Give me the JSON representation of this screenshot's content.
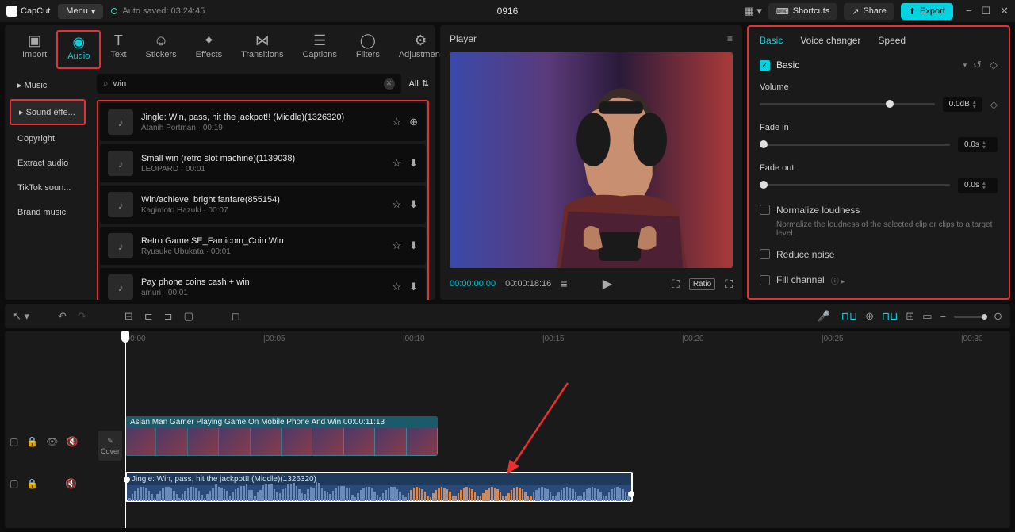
{
  "titlebar": {
    "app": "CapCut",
    "menu": "Menu",
    "autosave": "Auto saved: 03:24:45",
    "project": "0916",
    "shortcuts": "Shortcuts",
    "share": "Share",
    "export": "Export"
  },
  "top_tabs": {
    "import": "Import",
    "audio": "Audio",
    "text": "Text",
    "stickers": "Stickers",
    "effects": "Effects",
    "transitions": "Transitions",
    "captions": "Captions",
    "filters": "Filters",
    "adjustment": "Adjustment"
  },
  "sidebar": {
    "music": "Music",
    "sound_effects": "Sound effe...",
    "copyright": "Copyright",
    "extract": "Extract audio",
    "tiktok": "TikTok soun...",
    "brand": "Brand music"
  },
  "search": {
    "value": "win",
    "all": "All"
  },
  "sounds": [
    {
      "title": "Jingle: Win, pass, hit the jackpot!! (Middle)(1326320)",
      "sub": "Atanih Portman · 00:19",
      "add": true
    },
    {
      "title": "Small win (retro slot machine)(1139038)",
      "sub": "LEOPARD · 00:01",
      "add": false
    },
    {
      "title": "Win/achieve, bright fanfare(855154)",
      "sub": "Kagimoto Hazuki · 00:07",
      "add": false
    },
    {
      "title": "Retro Game SE_Famicom_Coin Win",
      "sub": "Ryusuke Ubukata · 00:01",
      "add": false
    },
    {
      "title": "Pay phone coins cash + win",
      "sub": "amuri · 00:01",
      "add": false
    }
  ],
  "player": {
    "label": "Player",
    "time_current": "00:00:00:00",
    "time_total": "00:00:18:16",
    "ratio": "Ratio"
  },
  "inspector": {
    "tab_basic": "Basic",
    "tab_voice": "Voice changer",
    "tab_speed": "Speed",
    "section_basic": "Basic",
    "volume": "Volume",
    "volume_val": "0.0dB",
    "fadein": "Fade in",
    "fadein_val": "0.0s",
    "fadeout": "Fade out",
    "fadeout_val": "0.0s",
    "normalize": "Normalize loudness",
    "normalize_desc": "Normalize the loudness of the selected clip or clips to a target level.",
    "reduce": "Reduce noise",
    "fill": "Fill channel"
  },
  "timeline": {
    "ticks": [
      "00:00",
      "00:05",
      "00:10",
      "00:15",
      "00:20",
      "00:25",
      "00:30"
    ],
    "video_clip": "Asian Man Gamer Playing Game On Mobile Phone And Win   00:00:11:13",
    "audio_clip": "Jingle: Win, pass, hit the jackpot!! (Middle)(1326320)",
    "cover": "Cover"
  }
}
